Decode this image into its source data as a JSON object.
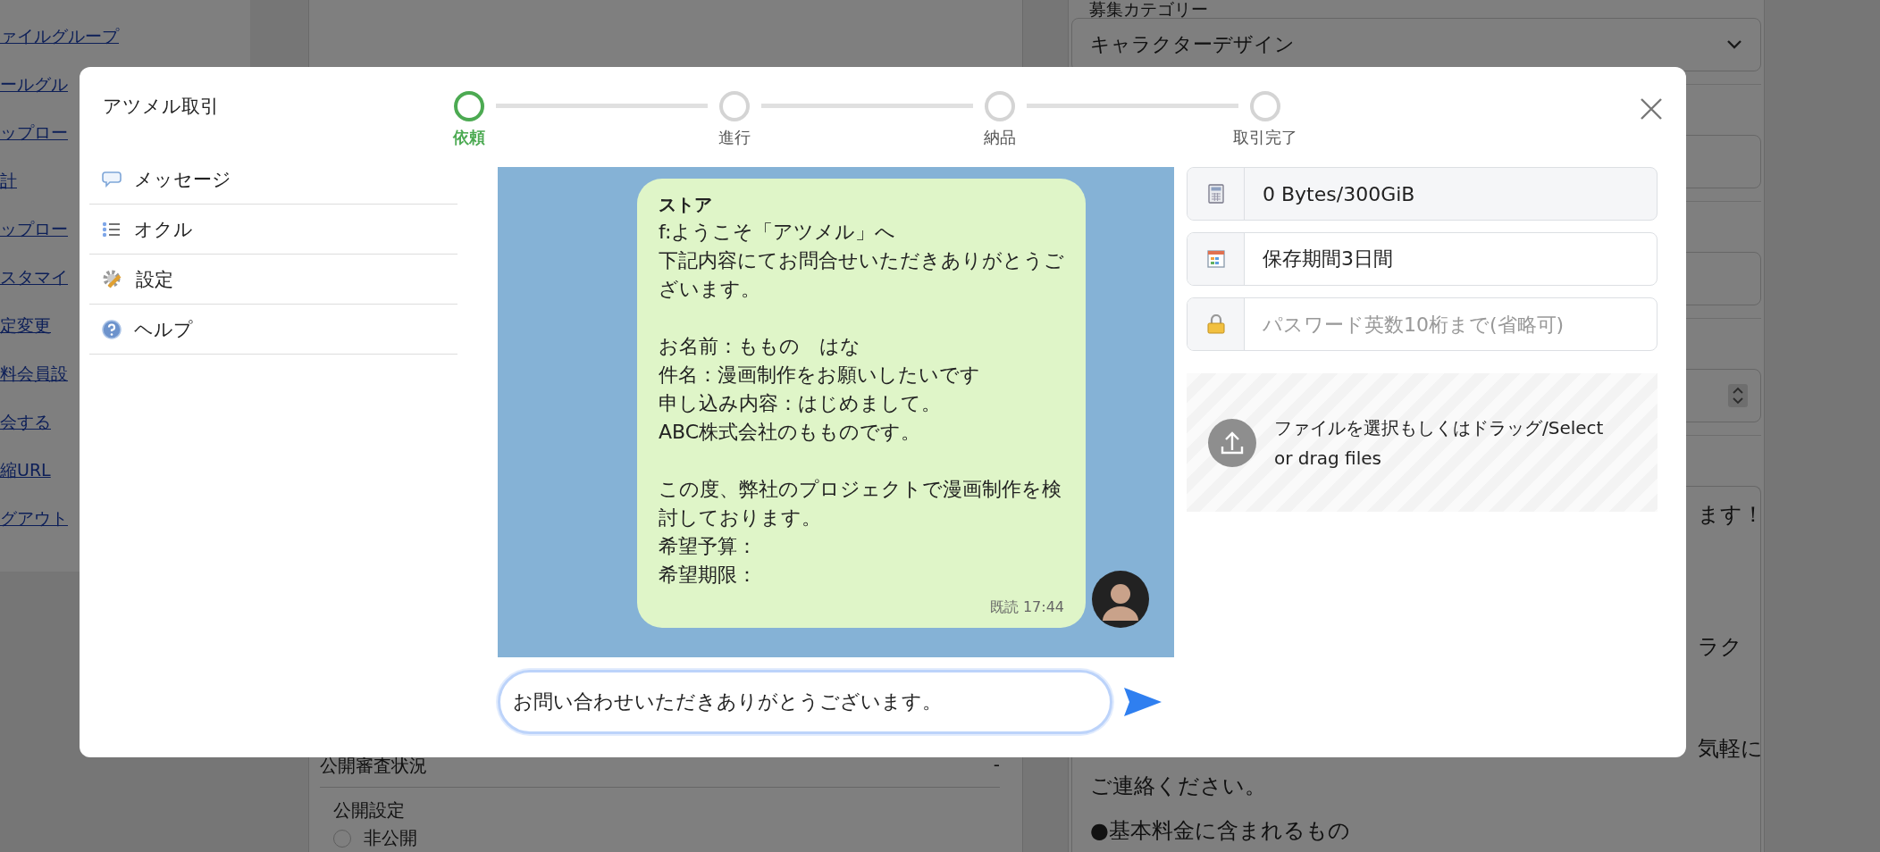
{
  "background_page": {
    "nav_links": [
      "ァイルグループ",
      "ールグル",
      "ップロー",
      "計",
      "ップロー",
      "スタマイ",
      "定変更",
      "料会員設",
      "会する",
      "縮URL",
      "グアウト"
    ],
    "left_card": {
      "status_label": "公開審査状況",
      "status_value": "-",
      "setting_label": "公開設定",
      "radio_options": [
        {
          "label": "非公開",
          "selected": false
        }
      ]
    },
    "right_card": {
      "category_label": "募集カテゴリー",
      "category_value": "キャラクターデザイン",
      "description_fragments": [
        "ます！",
        "ラク",
        "気軽に",
        "ご連絡ください。",
        "●基本料金に含まれるもの"
      ]
    }
  },
  "dialog": {
    "title": "アツメル取引",
    "steps": [
      {
        "label": "依頼",
        "selected": true
      },
      {
        "label": "進行",
        "selected": false
      },
      {
        "label": "納品",
        "selected": false
      },
      {
        "label": "取引完了",
        "selected": false
      }
    ],
    "menu": [
      {
        "label": "メッセージ"
      },
      {
        "label": "オクル"
      },
      {
        "label": "設定"
      },
      {
        "label": "ヘルプ"
      }
    ],
    "messages": [
      {
        "sender": "ストア",
        "paragraphs": [
          [
            "f:ようこそ「アツメル」へ",
            "下記内容にてお問合せいただきありがとうございます。"
          ],
          [
            "お名前：ももの　はな",
            "件名：漫画制作をお願いしたいです",
            "申し込み内容：はじめまして。",
            "ABC株式会社のもものです。"
          ],
          [
            "この度、弊社のプロジェクトで漫画制作を検討しております。",
            "希望予算：",
            "希望期限："
          ]
        ],
        "read_status": "既読 17:44"
      }
    ],
    "composer": {
      "value": "お問い合わせいただきありがとうございます。"
    },
    "file_panel": {
      "fields": [
        {
          "kind": "display",
          "value": "0 Bytes/300GiB"
        },
        {
          "kind": "input",
          "value": "保存期間3日間"
        },
        {
          "kind": "input",
          "placeholder": "パスワード英数10桁まで(省略可)"
        }
      ],
      "upload_prompt": "ファイルを選択もしくはドラッグ/Select or drag files"
    }
  }
}
